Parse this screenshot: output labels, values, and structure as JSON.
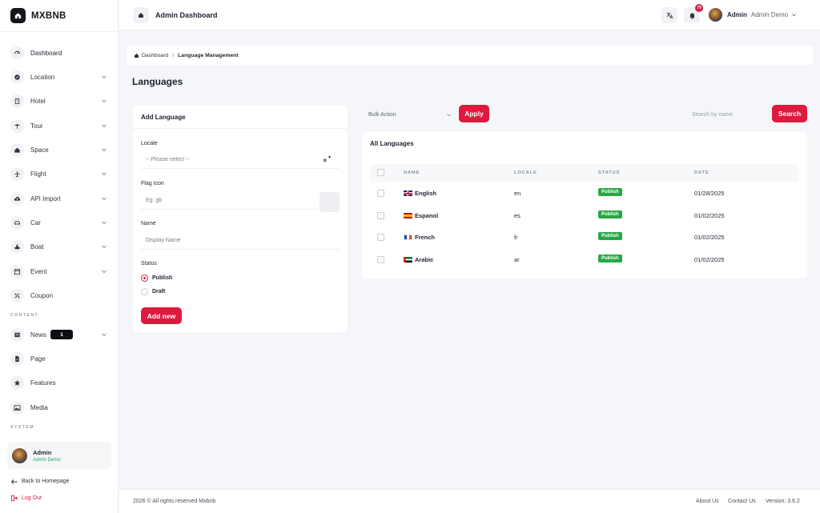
{
  "brand": {
    "name": "MXBNB"
  },
  "sidebar": {
    "items": [
      {
        "label": "Dashboard",
        "icon": "dashboard-icon",
        "has_children": false
      },
      {
        "label": "Location",
        "icon": "location-icon",
        "has_children": true
      },
      {
        "label": "Hotel",
        "icon": "hotel-icon",
        "has_children": true
      },
      {
        "label": "Tour",
        "icon": "tour-icon",
        "has_children": true
      },
      {
        "label": "Space",
        "icon": "space-icon",
        "has_children": true
      },
      {
        "label": "Flight",
        "icon": "flight-icon",
        "has_children": true
      },
      {
        "label": "API Import",
        "icon": "cloud-upload-icon",
        "has_children": true
      },
      {
        "label": "Car",
        "icon": "car-icon",
        "has_children": true
      },
      {
        "label": "Boat",
        "icon": "boat-icon",
        "has_children": true
      },
      {
        "label": "Event",
        "icon": "calendar-icon",
        "has_children": true
      },
      {
        "label": "Coupon",
        "icon": "coupon-icon",
        "has_children": false
      }
    ],
    "content_section": "CONTENT",
    "content_items": [
      {
        "label": "News",
        "icon": "news-icon",
        "badge": "1",
        "has_children": true
      },
      {
        "label": "Page",
        "icon": "page-icon",
        "has_children": false
      },
      {
        "label": "Features",
        "icon": "star-icon",
        "has_children": false
      },
      {
        "label": "Media",
        "icon": "image-icon",
        "has_children": false
      }
    ],
    "system_section": "SYSTEM",
    "user": {
      "name": "Admin",
      "role": "Admin Demo"
    },
    "back_link": "Back to Homepage",
    "logout_link": "Log Out"
  },
  "topbar": {
    "title": "Admin Dashboard",
    "notification_count": "79",
    "user_name": "Admin",
    "user_role": "Admin Demo"
  },
  "breadcrumb": {
    "home": "Dashboard",
    "separator": "/",
    "current": "Language Management"
  },
  "page": {
    "title": "Languages"
  },
  "add_form": {
    "title": "Add Language",
    "locale_label": "Locale",
    "locale_value": "-- Please select --",
    "flag_label": "Flag Icon",
    "flag_placeholder": "Eg: gb",
    "name_label": "Name",
    "name_placeholder": "Display Name",
    "status_label": "Status",
    "status_options": [
      {
        "label": "Publish",
        "selected": true
      },
      {
        "label": "Draft",
        "selected": false
      }
    ],
    "submit_label": "Add new"
  },
  "toolbar": {
    "bulk_action": "Bulk Action",
    "apply_label": "Apply",
    "search_placeholder": "Search by name",
    "search_label": "Search"
  },
  "table": {
    "title": "All Languages",
    "columns": [
      "NAME",
      "LOCALE",
      "STATUS",
      "DATE"
    ],
    "rows": [
      {
        "name": "English",
        "flag": "gb",
        "locale": "en",
        "status": "Publish",
        "date": "01/28/2025"
      },
      {
        "name": "Espanol",
        "flag": "es",
        "locale": "es",
        "status": "Publish",
        "date": "01/02/2025"
      },
      {
        "name": "French",
        "flag": "fr",
        "locale": "fr",
        "status": "Publish",
        "date": "01/02/2025"
      },
      {
        "name": "Arabic",
        "flag": "ae",
        "locale": "ar",
        "status": "Publish",
        "date": "01/02/2025"
      }
    ]
  },
  "footer": {
    "copyright": "2026 © All rights reserved Mxbnb",
    "about": "About Us",
    "contact": "Contact Us",
    "version": "Version: 3.6.2"
  },
  "colors": {
    "accent": "#e0193f",
    "success": "#27a844",
    "dark": "#14161c"
  }
}
